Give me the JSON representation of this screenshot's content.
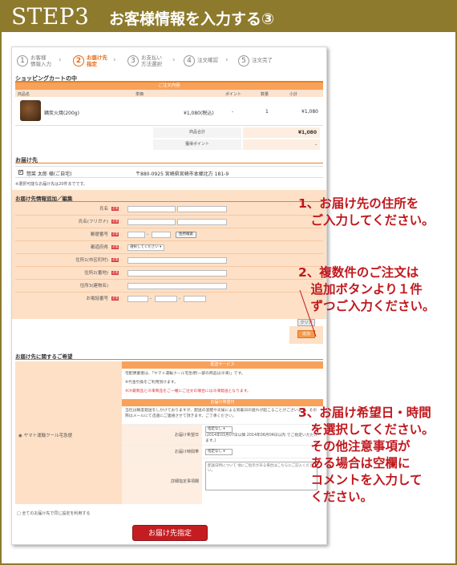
{
  "header": {
    "step": "STEP3",
    "title": "お客様情報を入力する③"
  },
  "steps": [
    {
      "num": "1",
      "label": "お客様\n情報入力"
    },
    {
      "num": "2",
      "label": "お届け先\n指定"
    },
    {
      "num": "3",
      "label": "お支払い\n方法選択"
    },
    {
      "num": "4",
      "label": "注文確認"
    },
    {
      "num": "5",
      "label": "注文完了"
    }
  ],
  "cart": {
    "title": "ショッピングカートの中",
    "bar": "ご注文内容",
    "cols": [
      "商品名",
      "単価",
      "ポイント",
      "数量",
      "小計"
    ],
    "item": {
      "name": "鶏炭火焼(200g)",
      "price": "¥1,080(税込)",
      "points": "-",
      "qty": "1",
      "subtotal": "¥1,080"
    },
    "total_label": "商品合計",
    "total_value": "¥1,080",
    "points_label": "獲得ポイント",
    "points_value": "-"
  },
  "destination": {
    "title": "お届け先",
    "name": "惣菜 太郎 様(ご自宅)",
    "address": "〒880-0925  宮崎県宮崎市本郷北方 181-9",
    "note": "※選択可能なお届け先は20件までです。"
  },
  "form": {
    "title": "お届け先情報追加／編集",
    "req": "必須",
    "fields": [
      "氏名",
      "氏名(フリガナ)",
      "郵便番号",
      "都道府県",
      "住所1(市区町村)",
      "住所2(番地)",
      "住所3(建物名)",
      "お電話番号"
    ],
    "zip_button": "住所検索",
    "pref_select": "選択してください",
    "clear_button": "クリア",
    "add_button": "追加"
  },
  "delivery": {
    "title": "お届け先に関するご希望",
    "service_bar": "配送サービス",
    "radio_label": "ヤマト運輸クール宅急便",
    "line1": "宅配便業者は、「ヤマト運輸クール宅急便(一部の商品は冷凍)」です。",
    "line2": "※代金引換をご利用頂けます。",
    "line3": "※冷蔵商品と冷凍商品をご一緒にご注文の場合には冷凍発送となります。",
    "date_bar": "お届け希望日",
    "notice": "当社は鮮度発送をしかけておりますが、配送の混雑や天候による到着日の遅れが起こることがございます。その際はメールにて迅速にご連絡させて頂きます。ご了承ください。",
    "date_label": "お届け希望日",
    "date_select": "指定なし",
    "date_hint": "(2014年03月07日以降 2014年06月04日以内 でご指定いただけます。)",
    "time_label": "お届け時間帯",
    "time_select": "指定なし",
    "detail_label": "詳細指定事項欄",
    "detail_placeholder": "配送日時について 他にご指示がある場合はこちらにご記入ください。"
  },
  "all_same": "□ 全てのお届け先で同じ設定を利用する",
  "submit": "お届け先指定",
  "annotations": {
    "a1": "1、お届け先の住所を\n　ご入力してください。",
    "a2": "2、複数件のご注文は\n　追加ボタンより１件\n　ずつご入力ください。",
    "a3": "3、お届け希望日・時間\n　を選択してください。\n　その他注意事項が\n　ある場合は空欄に\n　コメントを入力して\n　ください。"
  }
}
